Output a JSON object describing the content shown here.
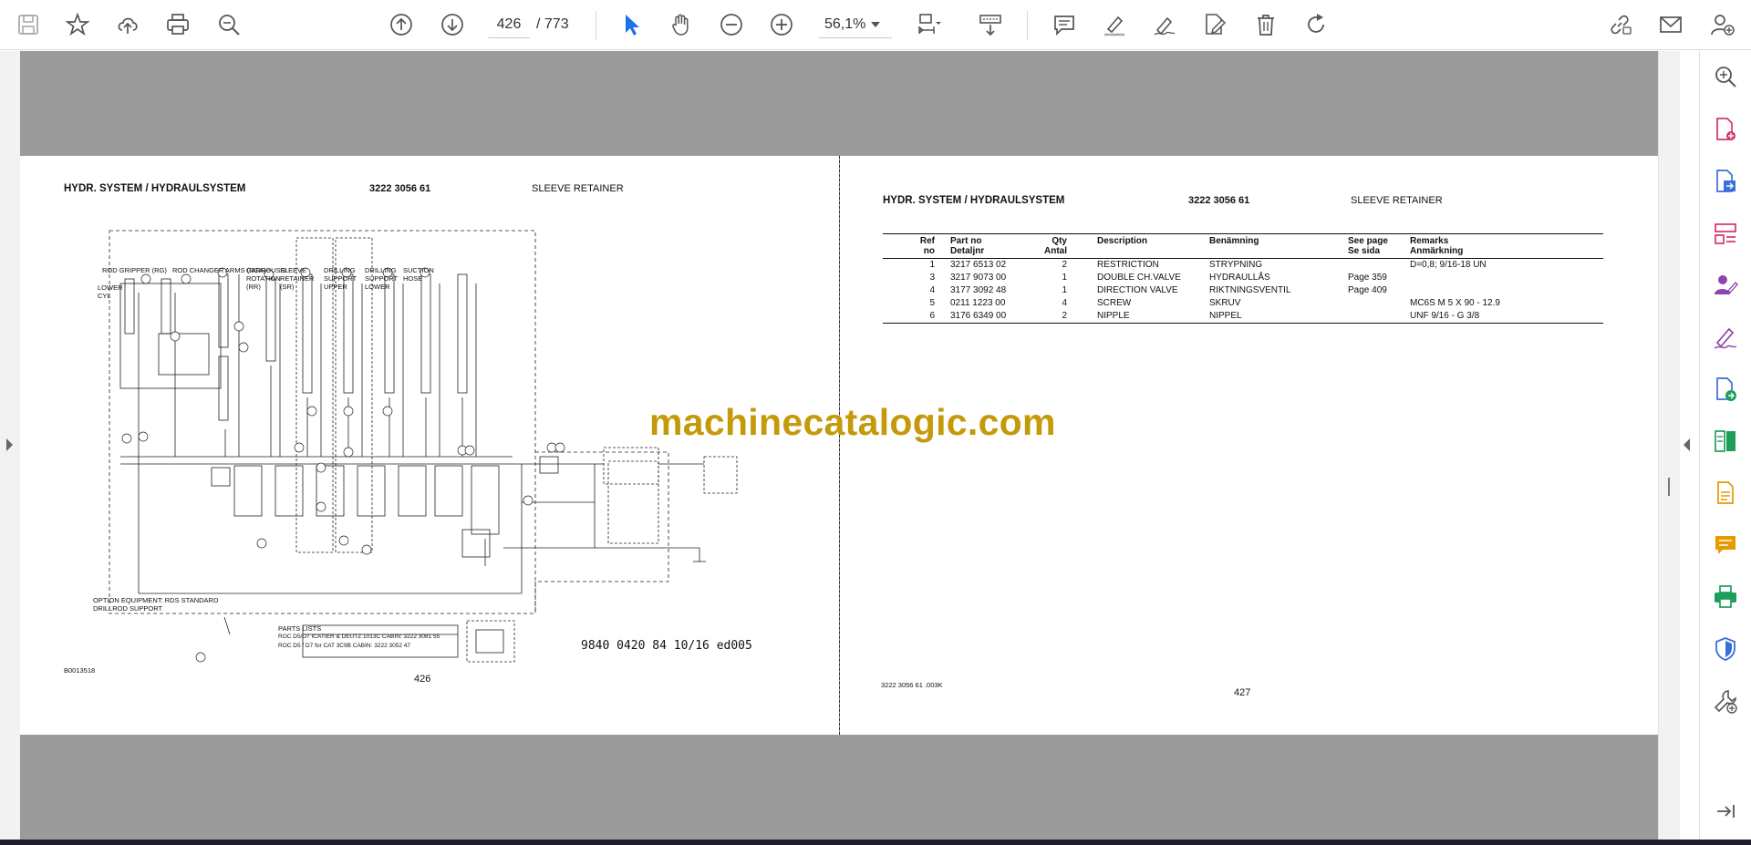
{
  "toolbar": {
    "icons": [
      "save-icon",
      "star-icon",
      "upload-icon",
      "print-icon",
      "zoom-search-icon",
      "page-up-icon",
      "page-down-icon",
      "select-cursor-icon",
      "hand-pan-icon",
      "zoom-out-icon",
      "zoom-in-icon",
      "fit-page-icon",
      "scroll-mode-icon",
      "comment-icon",
      "highlight-icon",
      "draw-sign-icon",
      "edit-pdf-icon",
      "delete-icon",
      "rotate-icon",
      "share-link-icon",
      "mail-icon",
      "account-icon"
    ],
    "current_page": "426",
    "total_pages": "/  773",
    "zoom": "56,1%"
  },
  "right_panel": {
    "icons": [
      "search-panel-icon",
      "create-pdf-icon",
      "export-pdf-icon",
      "organize-pages-icon",
      "request-signature-icon",
      "fill-sign-icon",
      "send-review-icon",
      "compare-files-icon",
      "combine-files-icon",
      "comment-panel-icon",
      "print-production-icon",
      "protect-icon",
      "more-tools-icon",
      "collapse-panel-icon"
    ]
  },
  "left_page": {
    "header_system": "HYDR. SYSTEM / HYDRAULSYSTEM",
    "header_partno": "3222 3056 61",
    "header_title": "SLEEVE RETAINER",
    "drawing_code": "9840 0420 84 10/16 ed005",
    "drawing_ref": "B0013518",
    "page_number": "426",
    "schematic_labels": {
      "rod_gripper": "ROD GRIPPER (RG)",
      "rod_changer": "ROD CHANGER ARMS (RCA)",
      "carousel": "CARROUSEL ROTATION (RR)",
      "sleeve_retainer": "SLEEVE RETAINER (SR)",
      "drilling_support_upper": "DRILLING SUPPORT UPPER",
      "drilling_support_lower": "DRILLING SUPPORT LOWER",
      "suction_hose": "SUCTION HOSE",
      "lower_cyl": "LOWER CYL",
      "option_note": "OPTION EQUIPMENT: RDS STANDARD DRILLROD SUPPORT",
      "parts_list_title": "PARTS LISTS",
      "parts_list_row1": "ROC D5/D7 ICATIER & DEUTZ 1013C CABIN:  3222 3081 55",
      "parts_list_row2": "ROC D5 / D7 for CAT 3C9B CABIN:  3222 3052 47"
    }
  },
  "right_page": {
    "header_system": "HYDR. SYSTEM / HYDRAULSYSTEM",
    "header_partno": "3222 3056 61",
    "header_title": "SLEEVE RETAINER",
    "table": {
      "headers": {
        "ref": [
          "Ref",
          "no"
        ],
        "partno": [
          "Part no",
          "Detaljnr"
        ],
        "qty": [
          "Qty",
          "Antal"
        ],
        "description": "Description",
        "benamning": "Benämning",
        "seepage": [
          "See page",
          "Se sida"
        ],
        "remarks": [
          "Remarks",
          "Anmärkning"
        ]
      },
      "rows": [
        {
          "ref": "1",
          "partno": "3217 6513 02",
          "qty": "2",
          "description": "RESTRICTION",
          "benamning": "STRYPNING",
          "seepage": "",
          "remarks": "D=0,8; 9/16-18 UN"
        },
        {
          "ref": "3",
          "partno": "3217 9073 00",
          "qty": "1",
          "description": "DOUBLE CH.VALVE",
          "benamning": "HYDRAULLÅS",
          "seepage": "Page 359",
          "remarks": ""
        },
        {
          "ref": "4",
          "partno": "3177 3092 48",
          "qty": "1",
          "description": "DIRECTION VALVE",
          "benamning": "RIKTNINGSVENTIL",
          "seepage": "Page 409",
          "remarks": ""
        },
        {
          "ref": "5",
          "partno": "0211 1223 00",
          "qty": "4",
          "description": "SCREW",
          "benamning": "SKRUV",
          "seepage": "",
          "remarks": "MC6S M 5 X 90 - 12.9"
        },
        {
          "ref": "6",
          "partno": "3176 6349 00",
          "qty": "2",
          "description": "NIPPLE",
          "benamning": "NIPPEL",
          "seepage": "",
          "remarks": "UNF  9/16 - G 3/8"
        }
      ]
    },
    "footer_code": "3222 3056 61 .003K",
    "page_number": "427"
  },
  "watermark": "machinecatalogic.com",
  "colors": {
    "accent_blue": "#1a73e8",
    "icon_gray": "#555555",
    "tool_pink": "#d6336c",
    "tool_blue": "#3b6fd9",
    "tool_purple": "#8e44ad",
    "tool_green": "#1e9e5a",
    "tool_orange": "#e69a00",
    "watermark_gold": "#c49a0a",
    "canvas_gray": "#9b9b9b"
  }
}
